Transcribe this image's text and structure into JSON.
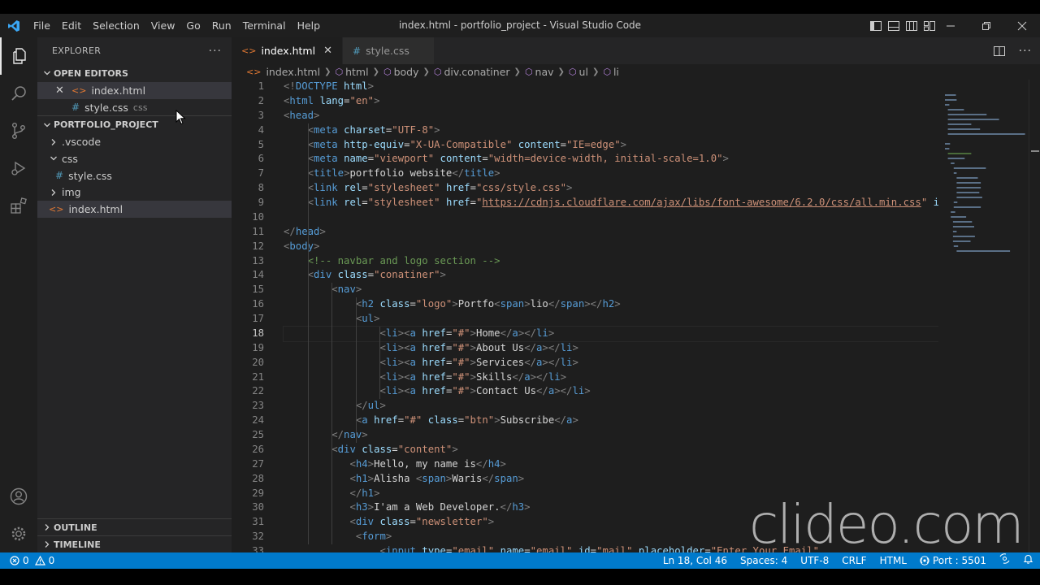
{
  "window": {
    "title": "index.html - portfolio_project - Visual Studio Code",
    "menu": [
      "File",
      "Edit",
      "Selection",
      "View",
      "Go",
      "Run",
      "Terminal",
      "Help"
    ]
  },
  "sidebar": {
    "header": "EXPLORER",
    "open_editors": {
      "label": "OPEN EDITORS",
      "items": [
        {
          "name": "index.html",
          "icon": "html-file-icon",
          "active": true
        },
        {
          "name": "style.css",
          "desc": "css",
          "icon": "css-file-icon"
        }
      ]
    },
    "project": {
      "label": "PORTFOLIO_PROJECT",
      "items": [
        {
          "name": ".vscode",
          "type": "folder",
          "expanded": false
        },
        {
          "name": "css",
          "type": "folder",
          "expanded": true
        },
        {
          "name": "style.css",
          "type": "file"
        },
        {
          "name": "img",
          "type": "folder",
          "expanded": false
        },
        {
          "name": "index.html",
          "type": "file",
          "selected": true
        }
      ]
    },
    "outline_label": "OUTLINE",
    "timeline_label": "TIMELINE"
  },
  "tabs": [
    {
      "label": "index.html",
      "active": true
    },
    {
      "label": "style.css",
      "active": false
    }
  ],
  "breadcrumb": [
    "index.html",
    "html",
    "body",
    "div.conatiner",
    "nav",
    "ul",
    "li"
  ],
  "editor": {
    "current_line": 18,
    "lines": [
      "<!DOCTYPE html>",
      "<html lang=\"en\">",
      "<head>",
      "    <meta charset=\"UTF-8\">",
      "    <meta http-equiv=\"X-UA-Compatible\" content=\"IE=edge\">",
      "    <meta name=\"viewport\" content=\"width=device-width, initial-scale=1.0\">",
      "    <title>portfolio website</title>",
      "    <link rel=\"stylesheet\" href=\"css/style.css\">",
      "    <link rel=\"stylesheet\" href=\"https://cdnjs.cloudflare.com/ajax/libs/font-awesome/6.2.0/css/all.min.css\" inte",
      "",
      "</head>",
      "<body>",
      "    <!-- navbar and logo section -->",
      "    <div class=\"conatiner\">",
      "        <nav>",
      "            <h2 class=\"logo\">Portfo<span>lio</span></h2>",
      "            <ul>",
      "                <li><a href=\"#\">Home</a></li>",
      "                <li><a href=\"#\">About Us</a></li>",
      "                <li><a href=\"#\">Services</a></li>",
      "                <li><a href=\"#\">Skills</a></li>",
      "                <li><a href=\"#\">Contact Us</a></li>",
      "            </ul>",
      "            <a href=\"#\" class=\"btn\">Subscribe</a>",
      "        </nav>",
      "        <div class=\"content\">",
      "           <h4>Hello, my name is</h4>",
      "           <h1>Alisha <span>Waris</span>",
      "           </h1>",
      "           <h3>I'am a Web Developer.</h3>",
      "           <div class=\"newsletter\">",
      "            <form>",
      "                <input type=\"email\" name=\"email\" id=\"mail\" placeholder=\"Enter Your Email\""
    ]
  },
  "statusbar": {
    "errors": "0",
    "warnings": "0",
    "position": "Ln 18, Col 46",
    "spaces": "Spaces: 4",
    "encoding": "UTF-8",
    "eol": "CRLF",
    "language": "HTML",
    "port": "Port : 5501"
  },
  "watermark": "clideo.com",
  "colors": {
    "accent": "#007acc",
    "tag": "#569cd6",
    "attribute": "#9cdcfe",
    "string": "#ce9178",
    "comment": "#6a9955"
  }
}
